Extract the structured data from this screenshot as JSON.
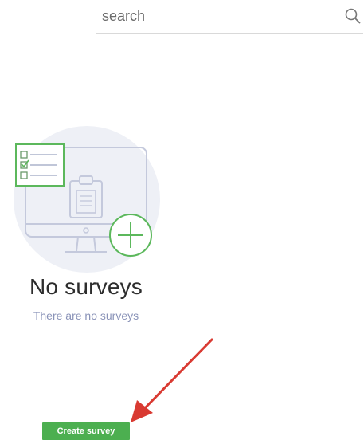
{
  "search": {
    "placeholder": "search",
    "value": "",
    "icon": "search-icon"
  },
  "empty_state": {
    "title": "No surveys",
    "subtitle": "There are no surveys",
    "illustration_icon": "survey-monitor-icon",
    "add_icon": "add-circle-icon"
  },
  "actions": {
    "create_label": "Create survey"
  },
  "annotation": {
    "arrow_icon": "red-arrow-icon",
    "color": "#d93a32"
  },
  "colors": {
    "accent": "#4caf50",
    "illustration_bg": "#eef0f6",
    "illustration_line": "#c4c9dc",
    "subtitle": "#8a93b8"
  }
}
